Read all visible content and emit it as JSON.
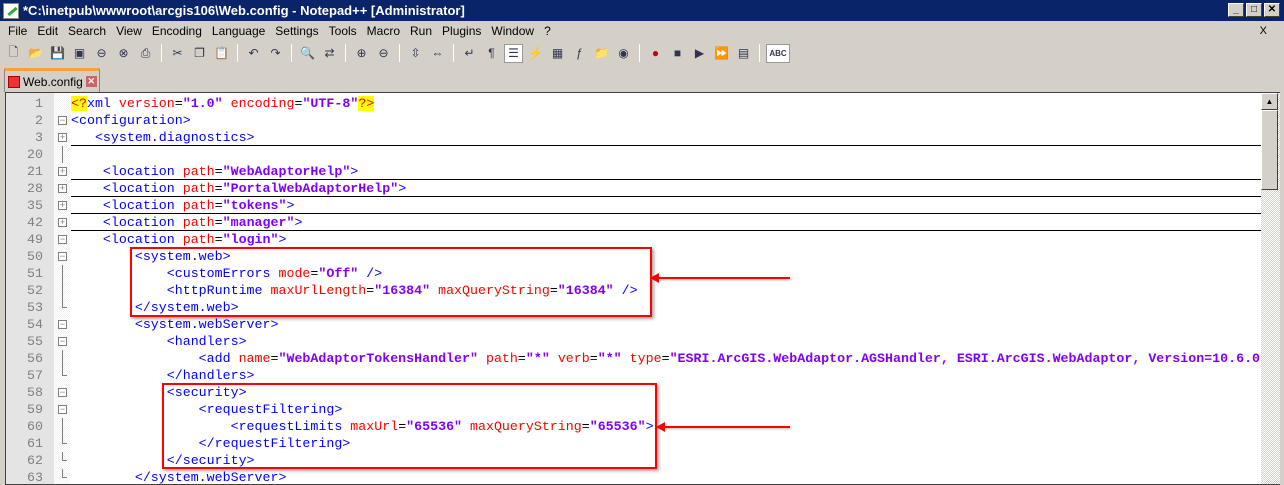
{
  "window": {
    "title": "*C:\\inetpub\\wwwroot\\arcgis106\\Web.config - Notepad++ [Administrator]",
    "minimize": "_",
    "maximize": "□",
    "close": "✕"
  },
  "menu": [
    "File",
    "Edit",
    "Search",
    "View",
    "Encoding",
    "Language",
    "Settings",
    "Tools",
    "Macro",
    "Run",
    "Plugins",
    "Window",
    "?"
  ],
  "menu_close": "X",
  "toolbar": [
    "new-file",
    "open-file",
    "save",
    "save-all",
    "close",
    "close-all",
    "print",
    "|",
    "cut",
    "copy",
    "paste",
    "|",
    "undo",
    "redo",
    "|",
    "find",
    "replace",
    "|",
    "zoom-in",
    "zoom-out",
    "|",
    "sync-vertical",
    "sync-horizontal",
    "|",
    "word-wrap",
    "show-all-chars",
    "indent-guide",
    "user-defined-language",
    "document-map",
    "function-list",
    "folder-as-workspace",
    "monitoring",
    "|",
    "record-macro",
    "stop-recording",
    "playback-macro",
    "run-macro-multiple",
    "save-macro",
    "|",
    "spell-check"
  ],
  "tab": {
    "label": "Web.config",
    "modified": true
  },
  "colors": {
    "tag": "#0000ff",
    "attribute": "#ff0000",
    "value": "#8000ff",
    "highlight": "#ff0000",
    "titlebar": "#0a246a"
  },
  "lines": [
    {
      "n": "1",
      "f": "",
      "c": [
        [
          "d",
          "<?"
        ],
        [
          "x",
          "xml "
        ],
        [
          "a",
          "version"
        ],
        [
          "p",
          "="
        ],
        [
          "v",
          "\"1.0\""
        ],
        [
          "p",
          " "
        ],
        [
          "a",
          "encoding"
        ],
        [
          "p",
          "="
        ],
        [
          "v",
          "\"UTF-8\""
        ],
        [
          "d",
          "?>"
        ]
      ]
    },
    {
      "n": "2",
      "f": "minus",
      "c": [
        [
          "t",
          "<configuration>"
        ]
      ]
    },
    {
      "n": "3",
      "f": "plus",
      "h": true,
      "c": [
        [
          "p",
          "   "
        ],
        [
          "t",
          "<system.diagnostics>"
        ]
      ]
    },
    {
      "n": "20",
      "f": "line",
      "c": []
    },
    {
      "n": "21",
      "f": "plus",
      "h": true,
      "c": [
        [
          "p",
          "    "
        ],
        [
          "t",
          "<location "
        ],
        [
          "a",
          "path"
        ],
        [
          "p",
          "="
        ],
        [
          "v",
          "\"WebAdaptorHelp\""
        ],
        [
          "t",
          ">"
        ]
      ]
    },
    {
      "n": "28",
      "f": "plus",
      "h": true,
      "c": [
        [
          "p",
          "    "
        ],
        [
          "t",
          "<location "
        ],
        [
          "a",
          "path"
        ],
        [
          "p",
          "="
        ],
        [
          "v",
          "\"PortalWebAdaptorHelp\""
        ],
        [
          "t",
          ">"
        ]
      ]
    },
    {
      "n": "35",
      "f": "plus",
      "h": true,
      "c": [
        [
          "p",
          "    "
        ],
        [
          "t",
          "<location "
        ],
        [
          "a",
          "path"
        ],
        [
          "p",
          "="
        ],
        [
          "v",
          "\"tokens\""
        ],
        [
          "t",
          ">"
        ]
      ]
    },
    {
      "n": "42",
      "f": "plus",
      "h": true,
      "c": [
        [
          "p",
          "    "
        ],
        [
          "t",
          "<location "
        ],
        [
          "a",
          "path"
        ],
        [
          "p",
          "="
        ],
        [
          "v",
          "\"manager\""
        ],
        [
          "t",
          ">"
        ]
      ]
    },
    {
      "n": "49",
      "f": "minus",
      "c": [
        [
          "p",
          "    "
        ],
        [
          "t",
          "<location "
        ],
        [
          "a",
          "path"
        ],
        [
          "p",
          "="
        ],
        [
          "v",
          "\"login\""
        ],
        [
          "t",
          ">"
        ]
      ]
    },
    {
      "n": "50",
      "f": "minus",
      "c": [
        [
          "p",
          "        "
        ],
        [
          "t",
          "<system.web>"
        ]
      ]
    },
    {
      "n": "51",
      "f": "line",
      "c": [
        [
          "p",
          "            "
        ],
        [
          "t",
          "<customErrors "
        ],
        [
          "a",
          "mode"
        ],
        [
          "p",
          "="
        ],
        [
          "v",
          "\"Off\""
        ],
        [
          "t",
          " />"
        ]
      ]
    },
    {
      "n": "52",
      "f": "line",
      "c": [
        [
          "p",
          "            "
        ],
        [
          "t",
          "<httpRuntime "
        ],
        [
          "a",
          "maxUrlLength"
        ],
        [
          "p",
          "="
        ],
        [
          "v",
          "\"16384\""
        ],
        [
          "p",
          " "
        ],
        [
          "a",
          "maxQueryString"
        ],
        [
          "p",
          "="
        ],
        [
          "v",
          "\"16384\""
        ],
        [
          "t",
          " />"
        ]
      ]
    },
    {
      "n": "53",
      "f": "end",
      "c": [
        [
          "p",
          "        "
        ],
        [
          "t",
          "</system.web>"
        ]
      ]
    },
    {
      "n": "54",
      "f": "minus",
      "c": [
        [
          "p",
          "        "
        ],
        [
          "t",
          "<system.webServer>"
        ]
      ]
    },
    {
      "n": "55",
      "f": "minus",
      "c": [
        [
          "p",
          "            "
        ],
        [
          "t",
          "<handlers>"
        ]
      ]
    },
    {
      "n": "56",
      "f": "line",
      "c": [
        [
          "p",
          "                "
        ],
        [
          "t",
          "<add "
        ],
        [
          "a",
          "name"
        ],
        [
          "p",
          "="
        ],
        [
          "v",
          "\"WebAdaptorTokensHandler\""
        ],
        [
          "p",
          " "
        ],
        [
          "a",
          "path"
        ],
        [
          "p",
          "="
        ],
        [
          "v",
          "\"*\""
        ],
        [
          "p",
          " "
        ],
        [
          "a",
          "verb"
        ],
        [
          "p",
          "="
        ],
        [
          "v",
          "\"*\""
        ],
        [
          "p",
          " "
        ],
        [
          "a",
          "type"
        ],
        [
          "p",
          "="
        ],
        [
          "v",
          "\"ESRI.ArcGIS.WebAdaptor.AGSHandler, ESRI.ArcGIS.WebAdaptor, Version=10.6.0"
        ]
      ]
    },
    {
      "n": "57",
      "f": "end",
      "c": [
        [
          "p",
          "            "
        ],
        [
          "t",
          "</handlers>"
        ]
      ]
    },
    {
      "n": "58",
      "f": "minus",
      "c": [
        [
          "p",
          "            "
        ],
        [
          "t",
          "<security>"
        ]
      ]
    },
    {
      "n": "59",
      "f": "minus",
      "c": [
        [
          "p",
          "                "
        ],
        [
          "t",
          "<requestFiltering>"
        ]
      ]
    },
    {
      "n": "60",
      "f": "line",
      "c": [
        [
          "p",
          "                    "
        ],
        [
          "t",
          "<requestLimits "
        ],
        [
          "a",
          "maxUrl"
        ],
        [
          "p",
          "="
        ],
        [
          "v",
          "\"65536\""
        ],
        [
          "p",
          " "
        ],
        [
          "a",
          "maxQueryString"
        ],
        [
          "p",
          "="
        ],
        [
          "v",
          "\"65536\""
        ],
        [
          "t",
          ">"
        ]
      ]
    },
    {
      "n": "61",
      "f": "end",
      "c": [
        [
          "p",
          "                "
        ],
        [
          "t",
          "</requestFiltering>"
        ]
      ]
    },
    {
      "n": "62",
      "f": "end",
      "c": [
        [
          "p",
          "            "
        ],
        [
          "t",
          "</security>"
        ]
      ]
    },
    {
      "n": "63",
      "f": "end",
      "c": [
        [
          "p",
          "        "
        ],
        [
          "t",
          "</system.webServer>"
        ]
      ]
    }
  ]
}
